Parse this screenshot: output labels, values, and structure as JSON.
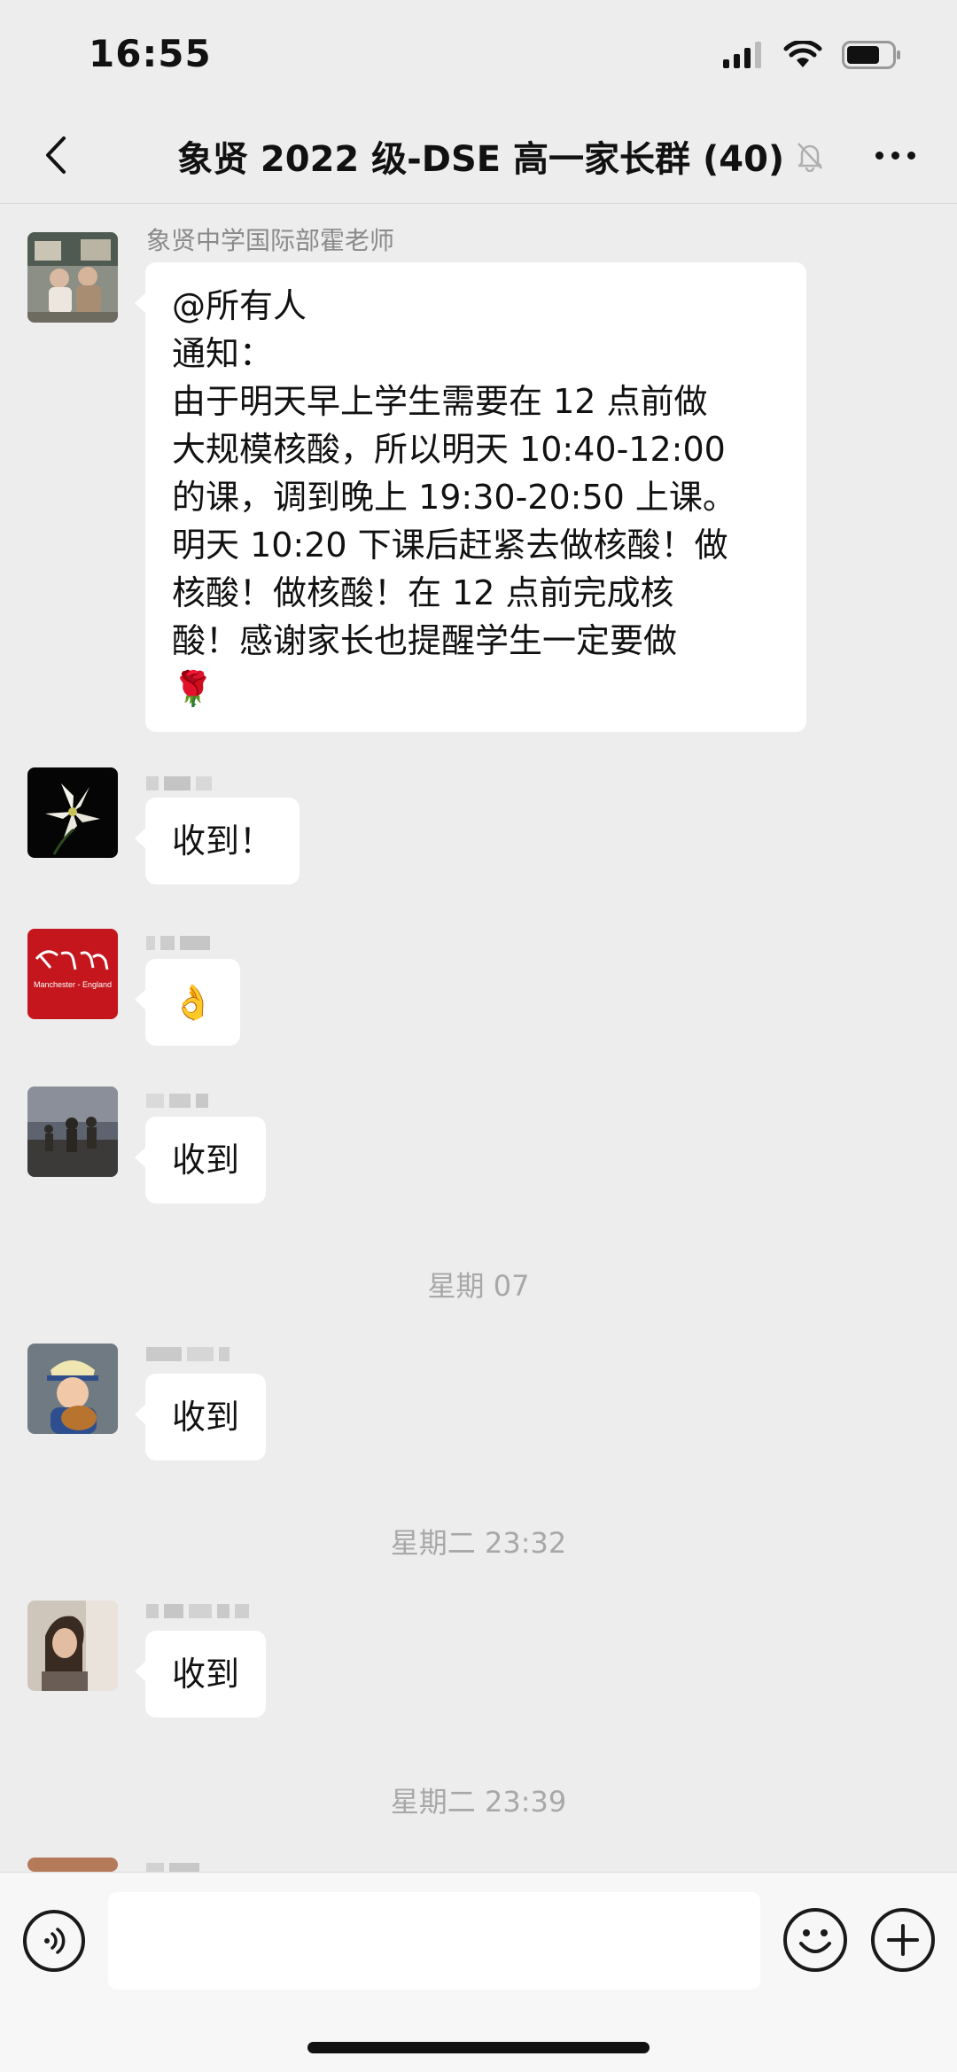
{
  "status_bar": {
    "time": "16:55"
  },
  "nav": {
    "title": "象贤 2022 级-DSE 高一家长群 (40)"
  },
  "messages": [
    {
      "sender": "象贤中学国际部霍老师",
      "lines": [
        "@所有人",
        "通知：",
        "由于明天早上学生需要在 12 点前做",
        "大规模核酸，所以明天 10:40-12:00",
        "的课，调到晚上 19:30-20:50 上课。",
        "明天 10:20 下课后赶紧去做核酸！做",
        "核酸！做核酸！在 12 点前完成核",
        "酸！感谢家长也提醒学生一定要做",
        "🌹"
      ]
    },
    {
      "sender": "",
      "text": "收到！"
    },
    {
      "sender": "",
      "text": "👌"
    },
    {
      "sender": "",
      "text": "收到"
    },
    {
      "sender": "",
      "text": "收到"
    },
    {
      "sender": "",
      "text": "收到"
    }
  ],
  "time_separators": [
    "星期  07",
    "星期二 23:32",
    "星期二 23:39"
  ],
  "icons": {
    "back": "chevron-left-icon",
    "mute": "bell-slash-icon",
    "more": "more-icon",
    "voice": "voice-icon",
    "emoji": "emoji-icon",
    "plus": "plus-icon"
  },
  "colors": {
    "background": "#ededed",
    "bubble": "#ffffff",
    "meta_text": "#a8a8a8"
  }
}
